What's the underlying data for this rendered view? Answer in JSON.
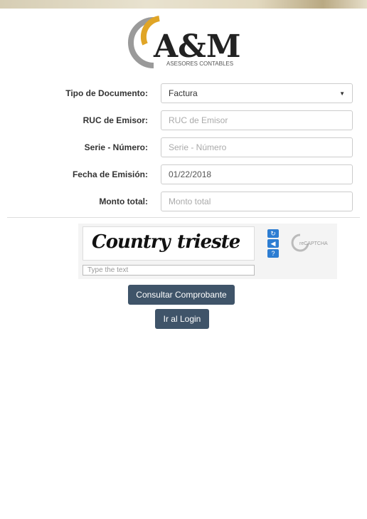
{
  "logo": {
    "text": "A&M",
    "subtitle": "ASESORES CONTABLES"
  },
  "form": {
    "tipo_documento": {
      "label": "Tipo de Documento:",
      "value": "Factura"
    },
    "ruc_emisor": {
      "label": "RUC de Emisor:",
      "placeholder": "RUC de Emisor",
      "value": ""
    },
    "serie_numero": {
      "label": "Serie - Número:",
      "placeholder": "Serie - Número",
      "value": ""
    },
    "fecha_emision": {
      "label": "Fecha de Emisión:",
      "value": "01/22/2018"
    },
    "monto_total": {
      "label": "Monto total:",
      "placeholder": "Monto total",
      "value": ""
    }
  },
  "captcha": {
    "words": [
      "Country",
      "trieste"
    ],
    "input_placeholder": "Type the text",
    "brand": "reCAPTCHA",
    "icons": [
      "refresh-icon",
      "audio-icon",
      "help-icon"
    ]
  },
  "buttons": {
    "consultar": "Consultar Comprobante",
    "login": "Ir al Login"
  },
  "colors": {
    "button_bg": "#3f5469",
    "captcha_button": "#2d7dd2",
    "logo_gold": "#e0a526",
    "logo_gray": "#9a9a9a"
  }
}
